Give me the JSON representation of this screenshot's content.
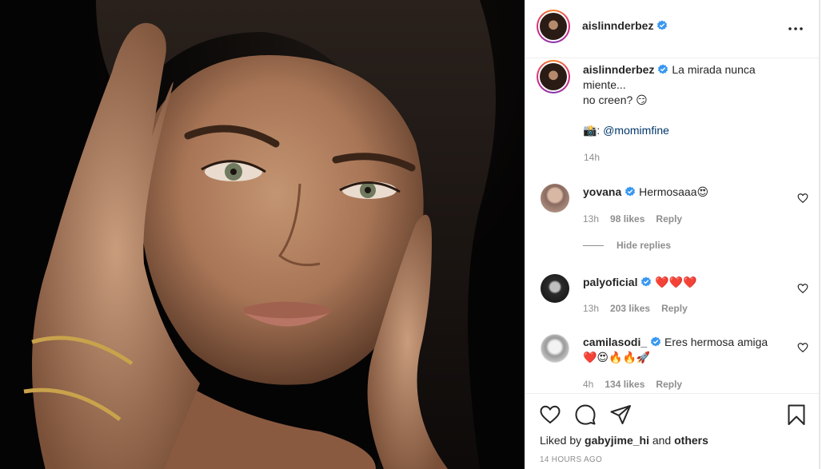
{
  "post": {
    "author": "aislinnderbez",
    "caption_line1": "La mirada nunca",
    "caption_line2": "miente...",
    "caption_line3": "no creen? 😏",
    "caption_credit_prefix": "📸:",
    "caption_mention": "@momimfine",
    "caption_time": "14h",
    "more_icon": "more-horizontal-icon",
    "photo_alt": "Close-up portrait photo"
  },
  "comments": [
    {
      "user": "yovana",
      "text": "Hermosaaa😍",
      "time": "13h",
      "likes": "98 likes",
      "reply": "Reply"
    },
    {
      "user": "palyoficial",
      "text": "❤️❤️❤️",
      "time": "13h",
      "likes": "203 likes",
      "reply": "Reply"
    },
    {
      "user": "camilasodi_",
      "text_line1": "Eres hermosa amiga",
      "text_line2": "❤️😍🔥🔥🚀",
      "time": "4h",
      "likes": "134 likes",
      "reply": "Reply"
    }
  ],
  "hide_replies": "Hide replies",
  "footer": {
    "liked_by_prefix": "Liked by",
    "liked_by_user": "gabyjime_hi",
    "liked_by_and": "and",
    "liked_by_others": "others",
    "post_time": "14 HOURS AGO"
  },
  "colors": {
    "verified_blue": "#3897f0",
    "link_blue": "#00376b",
    "muted_gray": "#8e8e8e"
  }
}
